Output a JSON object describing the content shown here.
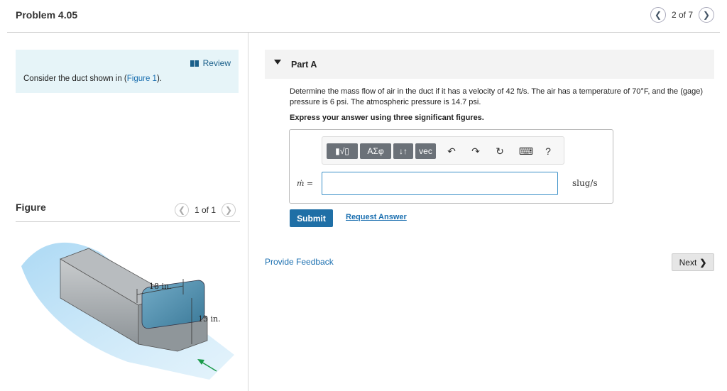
{
  "header": {
    "title": "Problem 4.05",
    "pager_text": "2 of 7"
  },
  "intro": {
    "review_label": "Review",
    "text_before": "Consider the duct shown in (",
    "figure_link": "Figure 1",
    "text_after": ")."
  },
  "figure_panel": {
    "title": "Figure",
    "pager_text": "1 of 1",
    "dim_width": "18 in.",
    "dim_height": "15 in."
  },
  "part": {
    "title": "Part A",
    "question": "Determine the mass flow of air in the duct if it has a velocity of 42 ft/s. The air has a temperature of 70°F, and the (gage) pressure is 6 psi. The atmospheric pressure is 14.7 psi.",
    "instruction": "Express your answer using three significant figures."
  },
  "answer": {
    "toolbar": {
      "template_label": "▮√▯",
      "greek_label": "ΑΣφ",
      "arrows_label": "↓↑",
      "vec_label": "vec",
      "undo_icon": "↶",
      "redo_icon": "↷",
      "reset_icon": "↻",
      "keyboard_icon": "⌨",
      "help_label": "?"
    },
    "variable_label": "ṁ =",
    "value": "",
    "units": "slug/s"
  },
  "actions": {
    "submit_label": "Submit",
    "request_label": "Request Answer",
    "feedback_label": "Provide Feedback",
    "next_label": "Next"
  },
  "colors": {
    "accent": "#1f6fa6",
    "link": "#1a6fb0",
    "intro_bg": "#e6f4f8"
  }
}
